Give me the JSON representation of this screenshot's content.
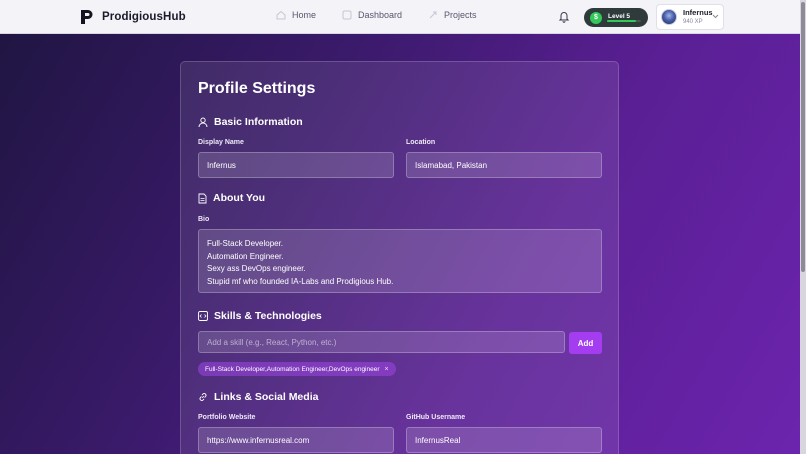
{
  "nav": {
    "brand": "ProdigiousHub",
    "links": [
      {
        "label": "Home"
      },
      {
        "label": "Dashboard"
      },
      {
        "label": "Projects"
      }
    ],
    "level": {
      "coin": "$",
      "label": "Level 5",
      "progress": 0.85
    },
    "user": {
      "name": "Infernus",
      "xp": "940 XP"
    }
  },
  "profile": {
    "title": "Profile Settings",
    "basic": {
      "heading": "Basic Information",
      "display_name_label": "Display Name",
      "display_name_value": "Infernus",
      "location_label": "Location",
      "location_value": "Islamabad, Pakistan"
    },
    "about": {
      "heading": "About You",
      "bio_label": "Bio",
      "bio_lines": [
        "Full-Stack Developer.",
        "Automation Engineer.",
        "Sexy ass DevOps engineer.",
        "Stupid mf who founded IA-Labs and Prodigious Hub."
      ]
    },
    "skills": {
      "heading": "Skills & Technologies",
      "placeholder": "Add a skill (e.g., React, Python, etc.)",
      "add_label": "Add",
      "chips": [
        "Full-Stack Developer,Automation Engineer,DevOps engineer"
      ],
      "chip_remove": "×"
    },
    "links": {
      "heading": "Links & Social Media",
      "portfolio_label": "Portfolio Website",
      "portfolio_value": "https://www.infernusreal.com",
      "github_label": "GitHub Username",
      "github_value": "InfernusReal"
    }
  },
  "colors": {
    "accent": "#a43cf0",
    "level_green": "#34c759"
  },
  "icons": [
    "brand-logo-icon",
    "home-icon",
    "dashboard-icon",
    "projects-icon",
    "bell-icon",
    "chevron-down-icon",
    "user-icon",
    "document-icon",
    "code-icon",
    "link-icon"
  ]
}
